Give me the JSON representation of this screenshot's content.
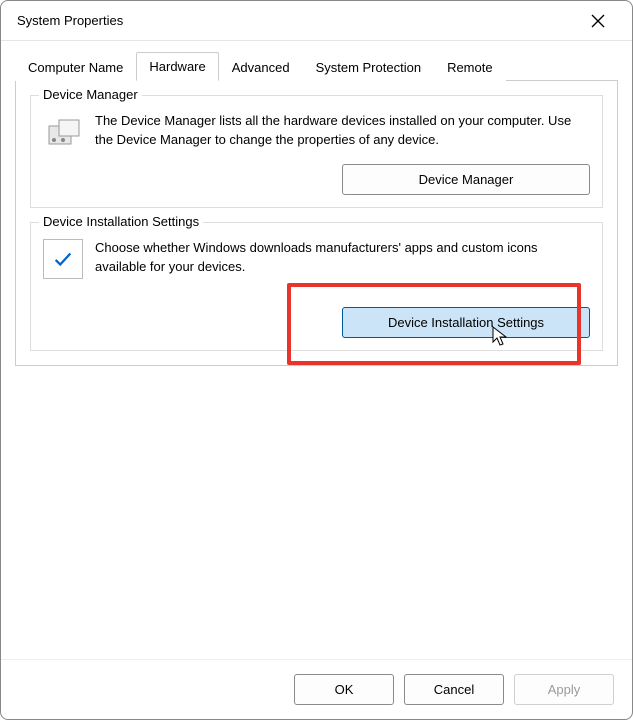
{
  "title": "System Properties",
  "tabs": {
    "computer_name": "Computer Name",
    "hardware": "Hardware",
    "advanced": "Advanced",
    "system_protection": "System Protection",
    "remote": "Remote"
  },
  "device_manager": {
    "label": "Device Manager",
    "desc": "The Device Manager lists all the hardware devices installed on your computer. Use the Device Manager to change the properties of any device.",
    "button": "Device Manager"
  },
  "device_install": {
    "label": "Device Installation Settings",
    "desc": "Choose whether Windows downloads manufacturers' apps and custom icons available for your devices.",
    "button": "Device Installation Settings"
  },
  "footer": {
    "ok": "OK",
    "cancel": "Cancel",
    "apply": "Apply"
  }
}
